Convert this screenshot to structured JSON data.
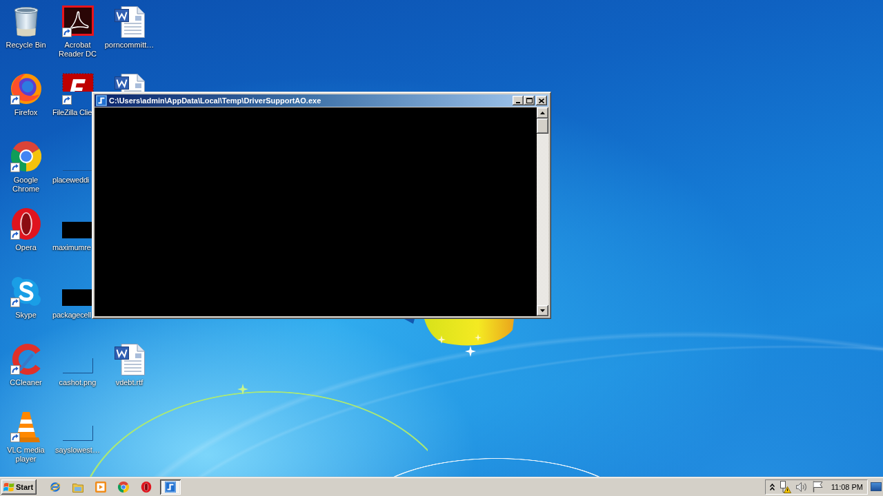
{
  "desktop": {
    "icon_rows": [
      [
        {
          "kind": "recycle-bin",
          "label": "Recycle Bin",
          "shortcut": false
        },
        {
          "kind": "acrobat",
          "label": "Acrobat Reader DC",
          "shortcut": true
        },
        {
          "kind": "word-doc",
          "label": "porncommitt…",
          "shortcut": false
        }
      ],
      [
        {
          "kind": "firefox",
          "label": "Firefox",
          "shortcut": true
        },
        {
          "kind": "filezilla",
          "label": "FileZilla Clie",
          "shortcut": true
        },
        {
          "kind": "word-doc",
          "shortcut": false
        }
      ],
      [
        {
          "kind": "chrome",
          "label": "Google Chrome",
          "shortcut": true
        },
        {
          "kind": "blank-image",
          "label": "placeweddi",
          "shortcut": false
        }
      ],
      [
        {
          "kind": "opera",
          "label": "Opera",
          "shortcut": true
        },
        {
          "kind": "black-image",
          "label": "maximumre",
          "shortcut": false
        }
      ],
      [
        {
          "kind": "skype",
          "label": "Skype",
          "shortcut": true
        },
        {
          "kind": "black-image",
          "label": "packagecell",
          "shortcut": false
        }
      ],
      [
        {
          "kind": "ccleaner",
          "label": "CCleaner",
          "shortcut": true
        },
        {
          "kind": "blank-image",
          "label": "cashot.png",
          "shortcut": false
        },
        {
          "kind": "word-doc",
          "label": "vdebt.rtf",
          "shortcut": false
        }
      ],
      [
        {
          "kind": "vlc",
          "label": "VLC media player",
          "shortcut": true
        },
        {
          "kind": "blank-image",
          "label": "sayslowest…",
          "shortcut": false
        }
      ]
    ]
  },
  "window": {
    "title": "C:\\Users\\admin\\AppData\\Local\\Temp\\DriverSupportAO.exe",
    "active": true
  },
  "taskbar": {
    "start_label": "Start",
    "quick_launch": [
      {
        "kind": "ie"
      },
      {
        "kind": "explorer"
      },
      {
        "kind": "media-player"
      },
      {
        "kind": "chrome"
      },
      {
        "kind": "opera"
      }
    ],
    "tasks": [
      {
        "kind": "console",
        "selected": true
      }
    ],
    "tray": {
      "icons": [
        {
          "kind": "chevron"
        },
        {
          "kind": "network-warning"
        },
        {
          "kind": "volume"
        },
        {
          "kind": "flag"
        }
      ],
      "clock": "11:08 PM"
    }
  }
}
